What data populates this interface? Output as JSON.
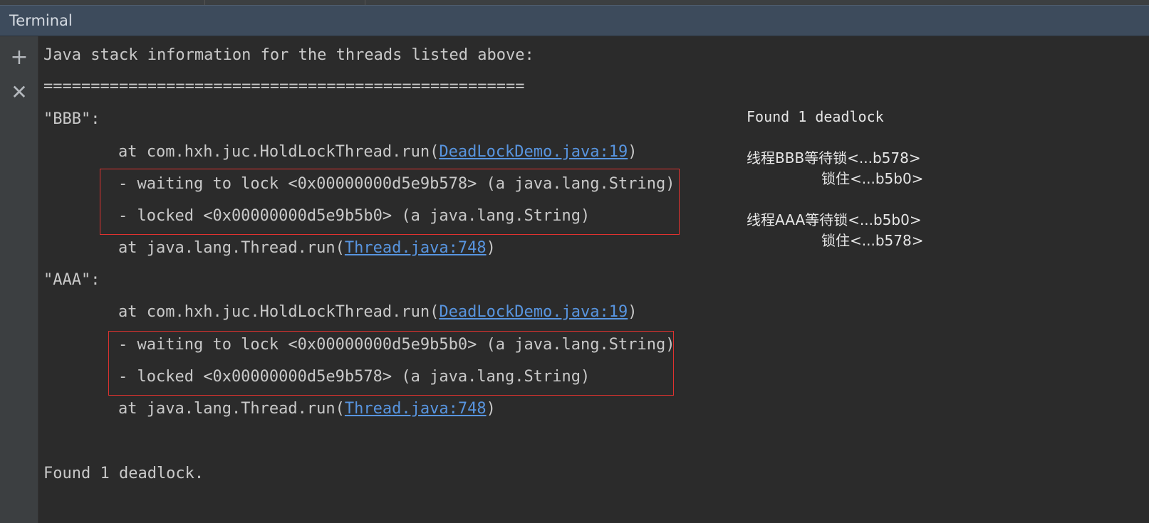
{
  "window": {
    "title": "Terminal"
  },
  "toolbar": {
    "add_icon": "plus-icon",
    "close_icon": "close-icon"
  },
  "console": {
    "header": "Java stack information for the threads listed above:",
    "separator": "===================================================",
    "thread_bbb": {
      "name": "\"BBB\":",
      "at_run_prefix": "at com.hxh.juc.HoldLockThread.run(",
      "at_run_link": "DeadLockDemo.java:19",
      "at_run_suffix": ")",
      "waiting": "- waiting to lock <0x00000000d5e9b578> (a java.lang.String)",
      "locked": "- locked <0x00000000d5e9b5b0> (a java.lang.String)",
      "thread_run_prefix": "at java.lang.Thread.run(",
      "thread_run_link": "Thread.java:748",
      "thread_run_suffix": ")"
    },
    "thread_aaa": {
      "name": "\"AAA\":",
      "at_run_prefix": "at com.hxh.juc.HoldLockThread.run(",
      "at_run_link": "DeadLockDemo.java:19",
      "at_run_suffix": ")",
      "waiting": "- waiting to lock <0x00000000d5e9b5b0> (a java.lang.String)",
      "locked": "- locked <0x00000000d5e9b578> (a java.lang.String)",
      "thread_run_prefix": "at java.lang.Thread.run(",
      "thread_run_link": "Thread.java:748",
      "thread_run_suffix": ")"
    },
    "footer": "Found 1 deadlock."
  },
  "annotation": {
    "heading": "Found 1 deadlock",
    "bbb_wait": "线程BBB等待锁<...b578>",
    "bbb_hold": "锁住<...b5b0>",
    "aaa_wait": "线程AAA等待锁<...b5b0>",
    "aaa_hold": "锁住<...b578>",
    "highlight_color": "#e0322f"
  }
}
